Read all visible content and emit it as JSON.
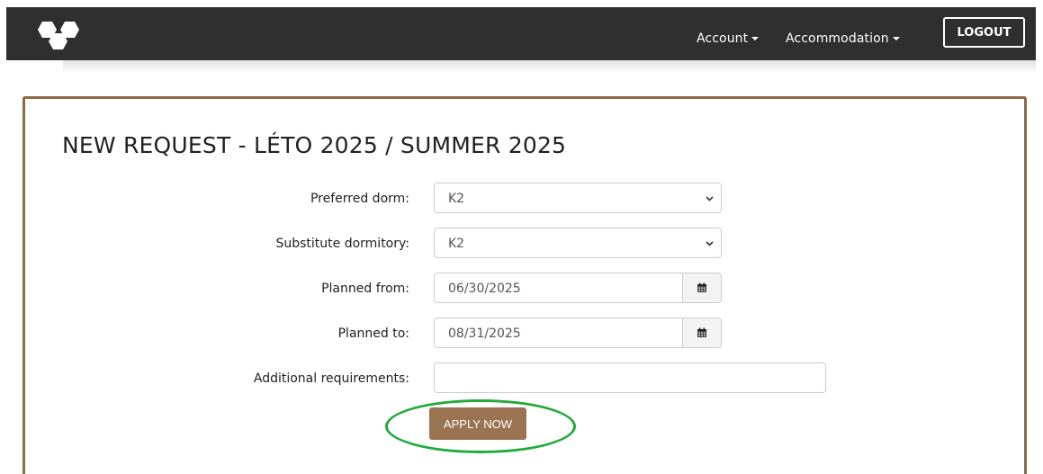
{
  "navbar": {
    "logo_icon": "hexagon-cluster-logo",
    "account_label": "Account",
    "accommodation_label": "Accommodation",
    "logout_label": "LOGOUT"
  },
  "page": {
    "title": "NEW REQUEST - LÉTO 2025 / SUMMER 2025"
  },
  "form": {
    "preferred_dorm": {
      "label": "Preferred dorm:",
      "value": "K2"
    },
    "substitute_dormitory": {
      "label": "Substitute dormitory:",
      "value": "K2"
    },
    "planned_from": {
      "label": "Planned from:",
      "value": "06/30/2025",
      "icon": "calendar-icon"
    },
    "planned_to": {
      "label": "Planned to:",
      "value": "08/31/2025",
      "icon": "calendar-icon"
    },
    "additional_requirements": {
      "label": "Additional requirements:",
      "value": ""
    },
    "apply_label": "APPLY NOW"
  },
  "colors": {
    "navbar_bg": "#2f2f2f",
    "brand_brown": "#9a7352",
    "card_border": "#8c6a47",
    "highlight_green": "#22aa3c"
  }
}
